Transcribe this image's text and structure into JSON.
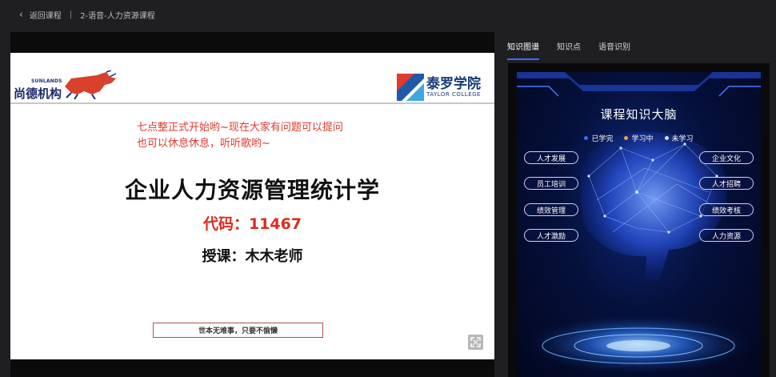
{
  "topbar": {
    "back_label": "返回课程",
    "separator": "|",
    "course_name": "2-语音-人力资源课程"
  },
  "slide": {
    "left_logo": {
      "small": "SUNLANDS",
      "name": "尚德机构"
    },
    "right_logo": {
      "name": "泰罗学院",
      "en": "TAYLOR COLLEGE"
    },
    "notice_line1": "七点整正式开始哟~现在大家有问题可以提问",
    "notice_line2": "也可以休息休息，听听歌哟~",
    "title": "企业人力资源管理统计学",
    "code": "代码：11467",
    "teacher": "授课：木木老师",
    "motto": "世本无难事，只要不偷懒"
  },
  "tabs": [
    {
      "label": "知识图谱",
      "active": true
    },
    {
      "label": "知识点",
      "active": false
    },
    {
      "label": "语音识别",
      "active": false
    }
  ],
  "knowledge_graph": {
    "title": "课程知识大脑",
    "legend": [
      {
        "label": "已学完",
        "color": "#3c6cff"
      },
      {
        "label": "学习中",
        "color": "#f5a623"
      },
      {
        "label": "未学习",
        "color": "#d9dbe6"
      }
    ],
    "left_nodes": [
      "人才发展",
      "员工培训",
      "绩效管理",
      "人才激励"
    ],
    "right_nodes": [
      "企业文化",
      "人才招聘",
      "绩效考核",
      "人力资源"
    ]
  },
  "colors": {
    "accent": "#3b6bff",
    "notice_red": "#e03a2e"
  }
}
